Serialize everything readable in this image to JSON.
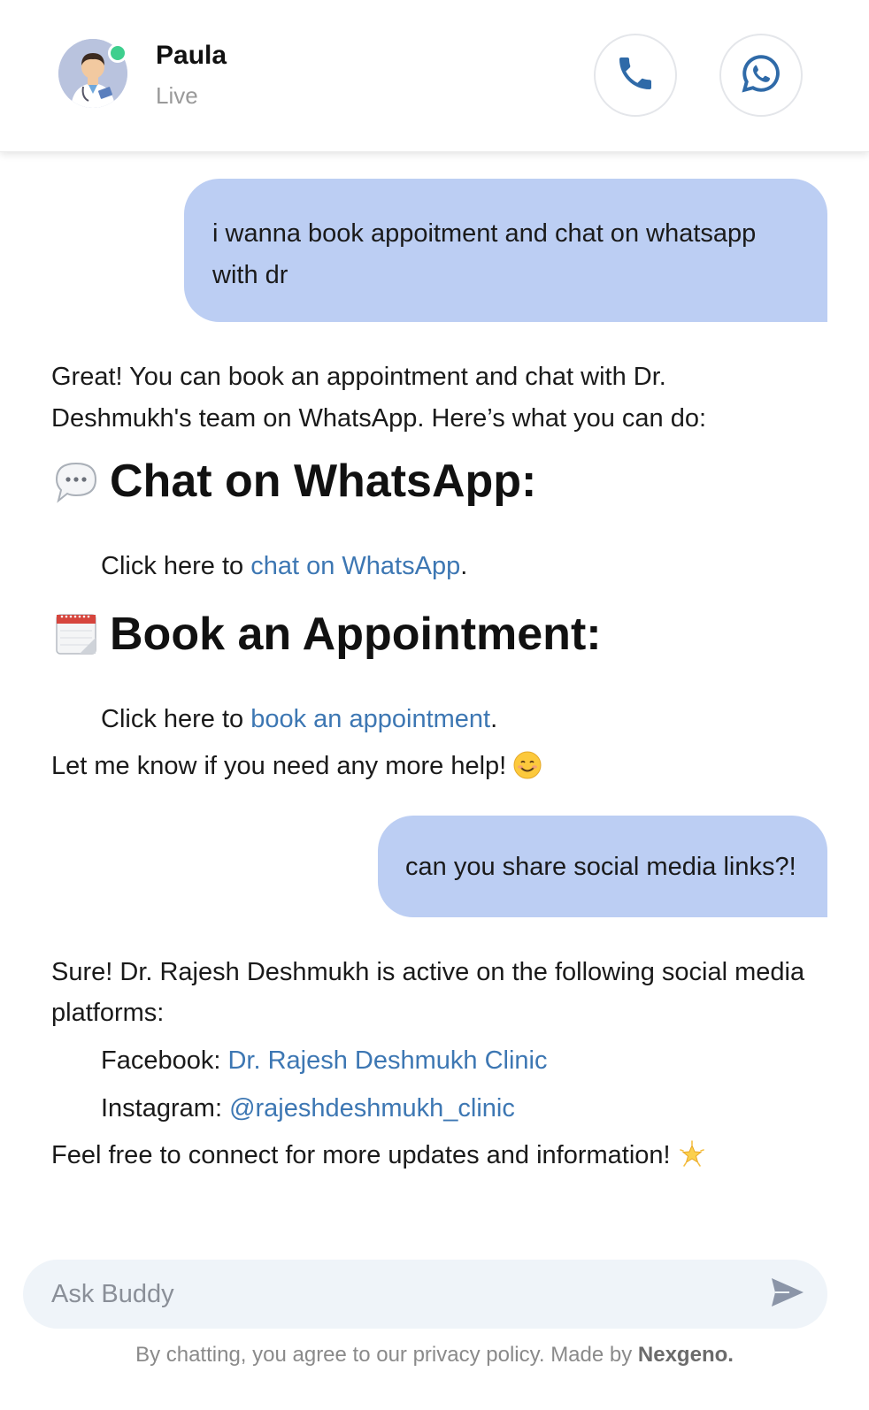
{
  "header": {
    "name": "Paula",
    "status": "Live",
    "call_icon": "phone-icon",
    "whatsapp_icon": "whatsapp-icon",
    "status_color": "#3ecf8e"
  },
  "messages": [
    {
      "role": "user",
      "text": "i wanna book appoitment and chat on whatsapp with dr"
    },
    {
      "role": "assistant",
      "intro_line1": "Great! You can book an appointment and chat with Dr.",
      "intro_line2": "Deshmukh's team on WhatsApp. Here’s what you can do:",
      "section1_icon": "speech-bubble-icon",
      "section1_heading": "Chat on WhatsApp:",
      "section1_prefix": "Click here to ",
      "section1_link": "chat on WhatsApp",
      "section1_suffix": ".",
      "section2_icon": "calendar-icon",
      "section2_heading": "Book an Appointment:",
      "section2_prefix": "Click here to ",
      "section2_link": "book an appointment",
      "section2_suffix": ".",
      "closing": "Let me know if you need any more help! ",
      "closing_emoji": "smiling-face-icon"
    },
    {
      "role": "user",
      "text": "can you share social media links?!"
    },
    {
      "role": "assistant",
      "intro_line1": "Sure! Dr. Rajesh Deshmukh is active on the following social media",
      "intro_line2": "platforms:",
      "facebook_label": "Facebook: ",
      "facebook_link": "Dr. Rajesh Deshmukh Clinic",
      "instagram_label": "Instagram: ",
      "instagram_link": "@rajeshdeshmukh_clinic",
      "closing": "Feel free to connect for more updates and information! ",
      "closing_emoji": "glowing-star-icon"
    }
  ],
  "composer": {
    "placeholder": "Ask Buddy",
    "send_icon": "send-icon"
  },
  "footer": {
    "text": "By chatting, you agree to our privacy policy. Made by ",
    "brand": "Nexgeno."
  },
  "colors": {
    "user_bubble": "#bccef3",
    "link": "#3d77b3",
    "input_bg": "#eff4f9"
  }
}
